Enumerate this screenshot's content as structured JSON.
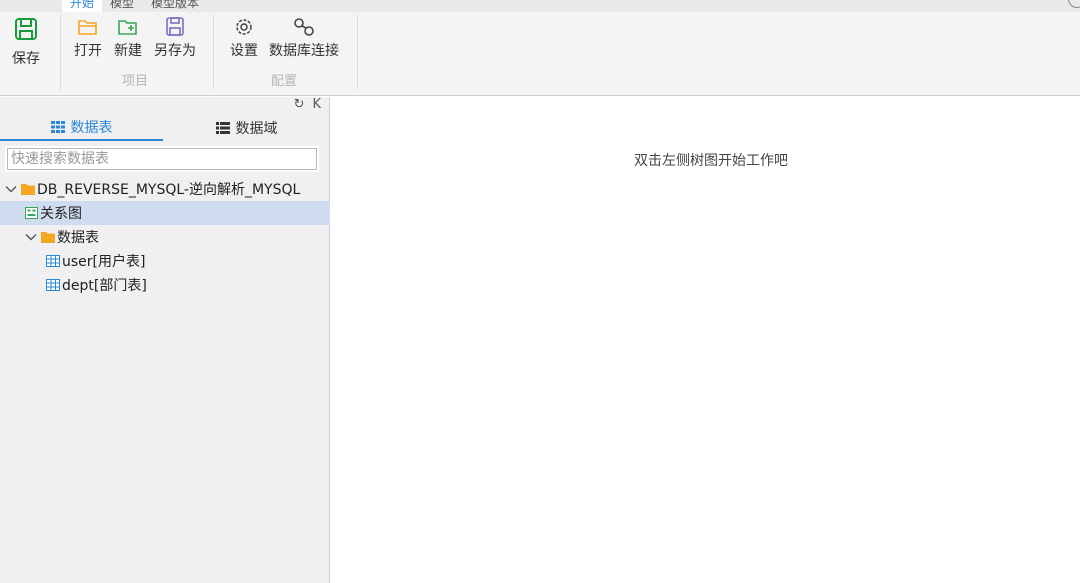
{
  "ribbon": {
    "tabs": [
      "开始",
      "模型",
      "模型版本"
    ],
    "save_label": "保存",
    "open_label": "打开",
    "new_label": "新建",
    "save_as_label": "另存为",
    "project_group": "项目",
    "settings_label": "设置",
    "db_connect_label": "数据库连接",
    "config_group": "配置"
  },
  "left_panel": {
    "refresh_glyph": "↻",
    "collapse_glyph": "K",
    "tabs": [
      "数据表",
      "数据域"
    ],
    "search_placeholder": "快速搜索数据表",
    "tree": {
      "root": "DB_REVERSE_MYSQL-逆向解析_MYSQL",
      "diagram": "关系图",
      "tables_folder": "数据表",
      "tables": [
        "user[用户表]",
        "dept[部门表]"
      ]
    }
  },
  "main": {
    "hint": "双击左侧树图开始工作吧"
  },
  "colors": {
    "accent": "#2b87d8",
    "save_green": "#1a9a3a",
    "folder_orange": "#f5a623",
    "selection": "#cfdcf0"
  }
}
